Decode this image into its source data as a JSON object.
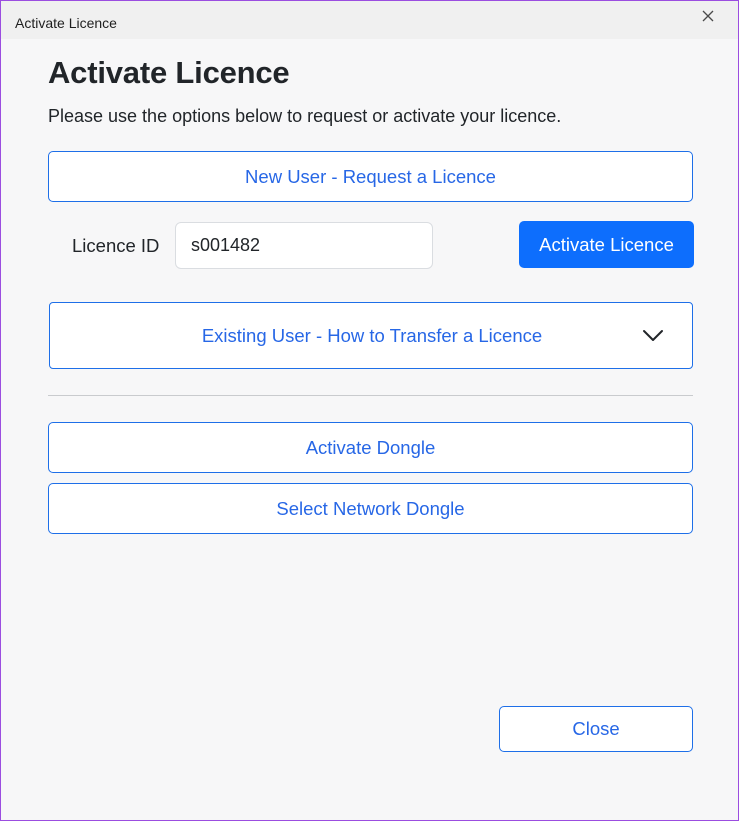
{
  "window": {
    "title": "Activate Licence"
  },
  "dialog": {
    "heading": "Activate Licence",
    "instructions": "Please use the options below to request or activate your licence.",
    "new_user_button": "New User - Request a Licence",
    "licence_id_label": "Licence ID",
    "licence_id_value": "s001482",
    "activate_button": "Activate Licence",
    "transfer_accordion": "Existing User - How to Transfer a Licence",
    "activate_dongle_button": "Activate Dongle",
    "network_dongle_button": "Select Network Dongle",
    "close_button": "Close"
  },
  "icons": {
    "window_close": "close-icon",
    "accordion_toggle": "chevron-down-icon"
  },
  "colors": {
    "accent": "#0d6efd",
    "outline_text": "#2767e6",
    "window_border": "#9b4de0"
  }
}
